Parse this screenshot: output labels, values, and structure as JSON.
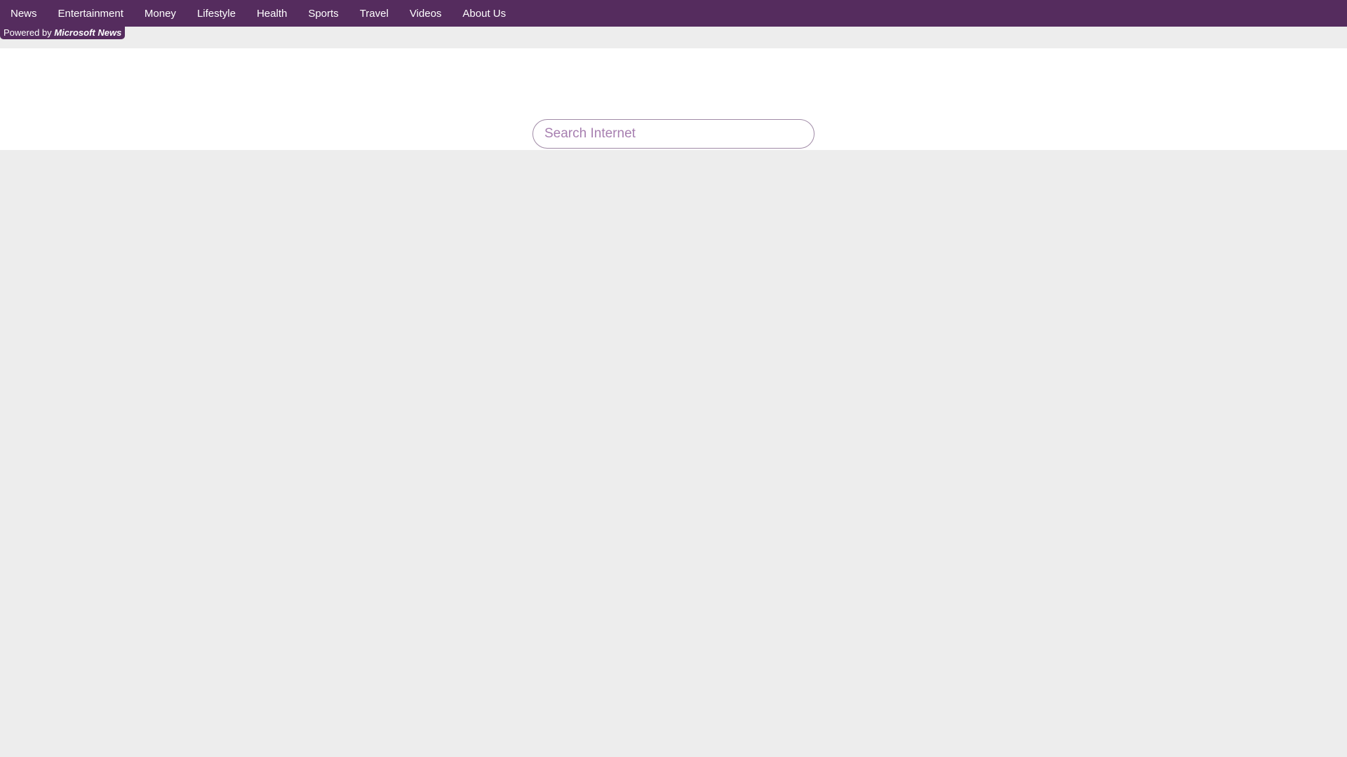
{
  "nav": {
    "items": [
      {
        "label": "News"
      },
      {
        "label": "Entertainment"
      },
      {
        "label": "Money"
      },
      {
        "label": "Lifestyle"
      },
      {
        "label": "Health"
      },
      {
        "label": "Sports"
      },
      {
        "label": "Travel"
      },
      {
        "label": "Videos"
      },
      {
        "label": "About Us"
      }
    ]
  },
  "badge": {
    "prefix": "Powered by ",
    "brand": "Microsoft News"
  },
  "search": {
    "value": "",
    "placeholder": "Search Internet"
  },
  "colors": {
    "nav_bg": "#552c5e",
    "page_bg": "#ededed",
    "hero_bg": "#ffffff",
    "placeholder": "#a77fb0"
  }
}
